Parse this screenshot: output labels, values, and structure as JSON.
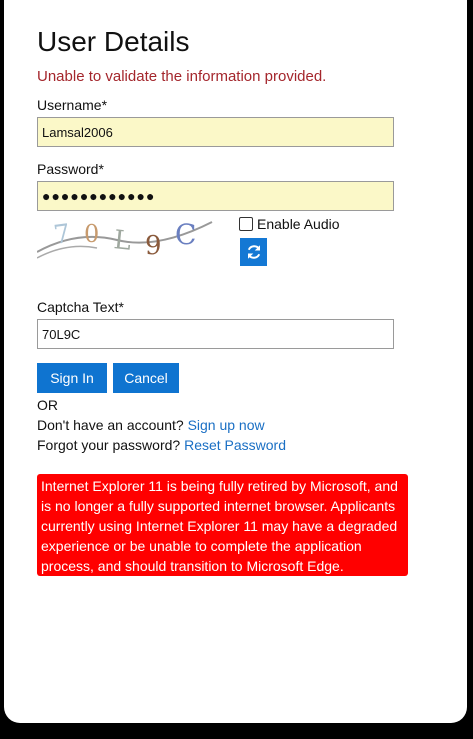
{
  "page": {
    "title": "User Details",
    "error_message": "Unable to validate the information provided."
  },
  "form": {
    "username_label": "Username*",
    "username_value": "Lamsal2006",
    "password_label": "Password*",
    "password_value": "●●●●●●●●●●●●",
    "captcha_image_text": "70L9C",
    "enable_audio_label": "Enable Audio",
    "enable_audio_checked": false,
    "captcha_label": "Captcha Text*",
    "captcha_value": "70L9C"
  },
  "buttons": {
    "sign_in": "Sign In",
    "cancel": "Cancel"
  },
  "links": {
    "or_text": "OR",
    "no_account_text": "Don't have an account?",
    "sign_up": "Sign up now",
    "forgot_text": "Forgot your password?",
    "reset": "Reset Password"
  },
  "notice": {
    "text": "Internet Explorer 11 is being fully retired by Microsoft, and is no longer a fully supported internet browser. Applicants currently using Internet Explorer 11 may have a degraded experience or be unable to complete the application process, and should transition to Microsoft Edge."
  },
  "colors": {
    "accent": "#0f74d0",
    "error": "#a4262c",
    "notice_bg": "#ff0000",
    "autofill_bg": "#fbf8c8"
  },
  "icons": {
    "refresh": "refresh-icon",
    "checkbox": "checkbox-icon"
  }
}
